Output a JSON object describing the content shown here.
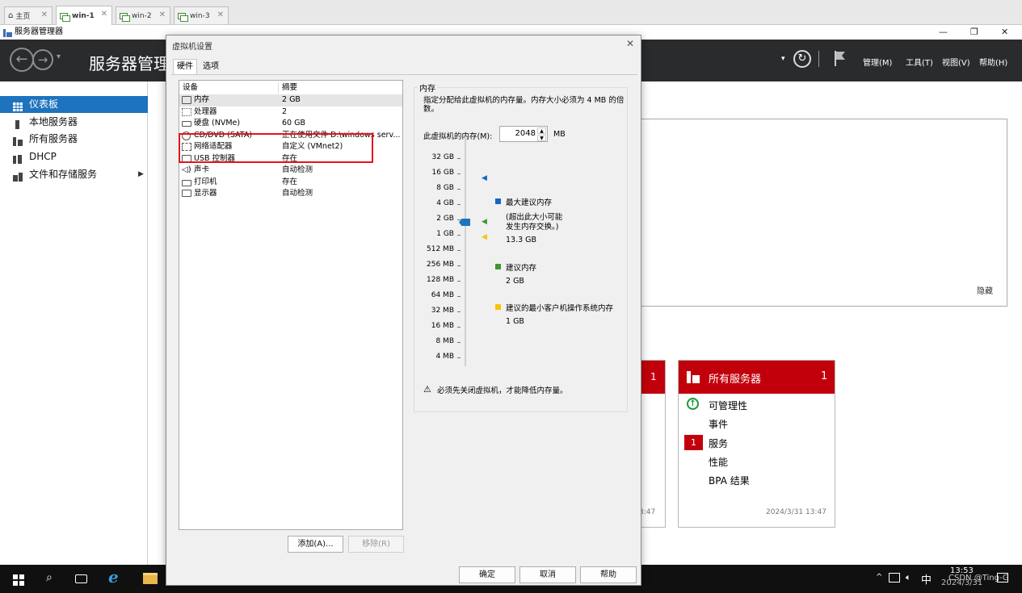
{
  "vm_tabs": [
    {
      "label": "主页",
      "active": false
    },
    {
      "label": "win-1",
      "active": true
    },
    {
      "label": "win-2",
      "active": false
    },
    {
      "label": "win-3",
      "active": false
    }
  ],
  "app_title": "服务器管理器",
  "header": {
    "title": "服务器管理",
    "menus": [
      "管理(M)",
      "工具(T)",
      "视图(V)",
      "帮助(H)"
    ]
  },
  "sidebar": {
    "items": [
      {
        "label": "仪表板",
        "selected": true
      },
      {
        "label": "本地服务器"
      },
      {
        "label": "所有服务器"
      },
      {
        "label": "DHCP"
      },
      {
        "label": "文件和存储服务"
      }
    ]
  },
  "welcome": {
    "hide_link": "隐藏"
  },
  "tiles": {
    "partial": {
      "count": "1",
      "timestamp": "3:47"
    },
    "all_servers": {
      "title": "所有服务器",
      "count": "1",
      "items": [
        {
          "label": "可管理性",
          "status": "ok"
        },
        {
          "label": "事件"
        },
        {
          "label": "服务",
          "badge": "1"
        },
        {
          "label": "性能"
        },
        {
          "label": "BPA 结果"
        }
      ],
      "timestamp": "2024/3/31 13:47"
    }
  },
  "dialog": {
    "title": "虚拟机设置",
    "tabs": [
      "硬件",
      "选项"
    ],
    "columns": {
      "device": "设备",
      "summary": "摘要"
    },
    "devices": [
      {
        "name": "内存",
        "summary": "2 GB",
        "icon": "memory-icon",
        "selected": true
      },
      {
        "name": "处理器",
        "summary": "2",
        "icon": "cpu-icon"
      },
      {
        "name": "硬盘 (NVMe)",
        "summary": "60 GB",
        "icon": "disk-icon"
      },
      {
        "name": "CD/DVD (SATA)",
        "summary": "正在使用文件 D:\\windows serv...",
        "icon": "cdrom-icon"
      },
      {
        "name": "网络适配器",
        "summary": "自定义 (VMnet2)",
        "icon": "network-icon"
      },
      {
        "name": "USB 控制器",
        "summary": "存在",
        "icon": "usb-icon"
      },
      {
        "name": "声卡",
        "summary": "自动检测",
        "icon": "sound-icon"
      },
      {
        "name": "打印机",
        "summary": "存在",
        "icon": "printer-icon"
      },
      {
        "name": "显示器",
        "summary": "自动检测",
        "icon": "display-icon"
      }
    ],
    "add_button": "添加(A)...",
    "remove_button": "移除(R)",
    "memory": {
      "group_title": "内存",
      "description": "指定分配给此虚拟机的内存量。内存大小必须为 4 MB 的倍数。",
      "field_label": "此虚拟机的内存(M):",
      "value": "2048",
      "unit": "MB",
      "scale": [
        "32 GB",
        "16 GB",
        "8 GB",
        "4 GB",
        "2 GB",
        "1 GB",
        "512 MB",
        "256 MB",
        "128 MB",
        "64 MB",
        "32 MB",
        "16 MB",
        "8 MB",
        "4 MB"
      ],
      "legend": {
        "max": {
          "label": "最大建议内存",
          "note_line1": "(超出此大小可能",
          "note_line2": "发生内存交换。)",
          "value": "13.3 GB",
          "color": "#1266c4"
        },
        "recommended": {
          "label": "建议内存",
          "value": "2 GB",
          "color": "#3a9a2a"
        },
        "min": {
          "label": "建议的最小客户机操作系统内存",
          "value": "1 GB",
          "color": "#f5c400"
        }
      },
      "warning": "必须先关闭虚拟机，才能降低内存量。"
    },
    "ok_button": "确定",
    "cancel_button": "取消",
    "help_button": "帮助"
  },
  "taskbar": {
    "ime": "中",
    "time": "13:53",
    "date": "2024/3/31",
    "watermark": "CSDN @Ting-G"
  }
}
